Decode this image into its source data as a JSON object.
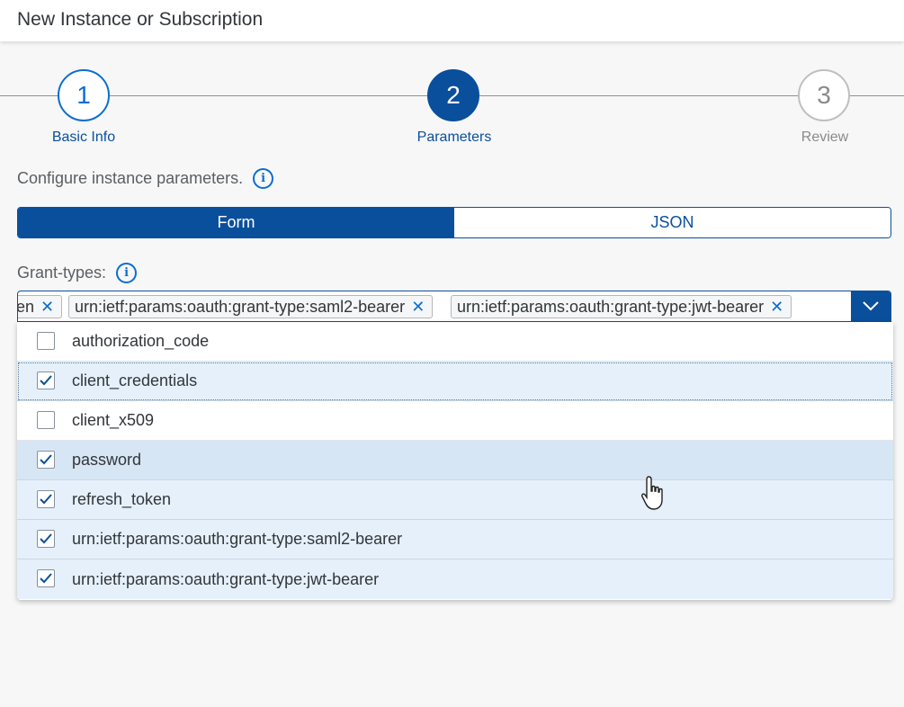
{
  "dialog": {
    "title": "New Instance or Subscription"
  },
  "wizard": {
    "steps": [
      {
        "number": "1",
        "label": "Basic Info"
      },
      {
        "number": "2",
        "label": "Parameters"
      },
      {
        "number": "3",
        "label": "Review"
      }
    ],
    "current_step": 2
  },
  "configure_text": "Configure instance parameters.",
  "mode_toggle": {
    "form_label": "Form",
    "json_label": "JSON",
    "selected": "Form"
  },
  "grant_types": {
    "label": "Grant-types:",
    "tokens": [
      {
        "text": "ken"
      },
      {
        "text": "urn:ietf:params:oauth:grant-type:saml2-bearer"
      },
      {
        "text": "urn:ietf:params:oauth:grant-type:jwt-bearer"
      }
    ],
    "options": [
      {
        "label": "authorization_code",
        "checked": false
      },
      {
        "label": "client_credentials",
        "checked": true
      },
      {
        "label": "client_x509",
        "checked": false
      },
      {
        "label": "password",
        "checked": true
      },
      {
        "label": "refresh_token",
        "checked": true
      },
      {
        "label": "urn:ietf:params:oauth:grant-type:saml2-bearer",
        "checked": true
      },
      {
        "label": "urn:ietf:params:oauth:grant-type:jwt-bearer",
        "checked": true
      }
    ]
  },
  "colors": {
    "accent": "#0a4f9c",
    "link": "#0a6ed1",
    "selected_row": "#e5f0fa",
    "hover_row": "#d7e6f4"
  }
}
